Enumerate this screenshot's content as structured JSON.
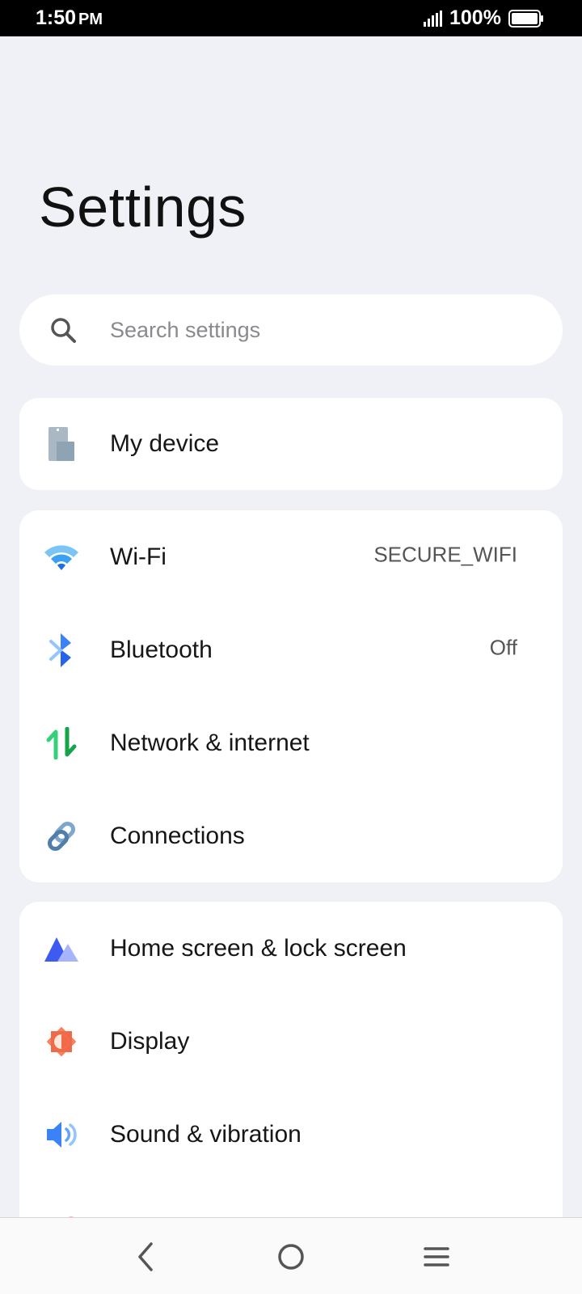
{
  "status_bar": {
    "time": "1:50",
    "ampm": "PM",
    "battery_percent": "100%",
    "battery_level": 1.0
  },
  "header": {
    "title": "Settings"
  },
  "search": {
    "placeholder": "Search settings",
    "value": ""
  },
  "device_card": {
    "items": [
      {
        "label": "My device",
        "icon": "phone-device-icon"
      }
    ]
  },
  "network_card": {
    "items": [
      {
        "label": "Wi-Fi",
        "value": "SECURE_WIFI",
        "icon": "wifi-icon",
        "color": "#2f8cf0"
      },
      {
        "label": "Bluetooth",
        "value": "Off",
        "icon": "bluetooth-icon",
        "color": "#3b82f6"
      },
      {
        "label": "Network & internet",
        "icon": "network-arrows-icon",
        "color": "#22c55e"
      },
      {
        "label": "Connections",
        "icon": "link-icon",
        "color": "#5b8db8"
      }
    ]
  },
  "system_card": {
    "items": [
      {
        "label": "Home screen & lock screen",
        "icon": "home-screen-icon",
        "color": "#4f6af0"
      },
      {
        "label": "Display",
        "icon": "display-brightness-icon",
        "color": "#f07a5a"
      },
      {
        "label": "Sound & vibration",
        "icon": "speaker-icon",
        "color": "#3b82f6"
      }
    ]
  },
  "navigation": {
    "back_icon": "back-chevron-icon",
    "home_icon": "home-circle-icon",
    "menu_icon": "menu-lines-icon"
  }
}
